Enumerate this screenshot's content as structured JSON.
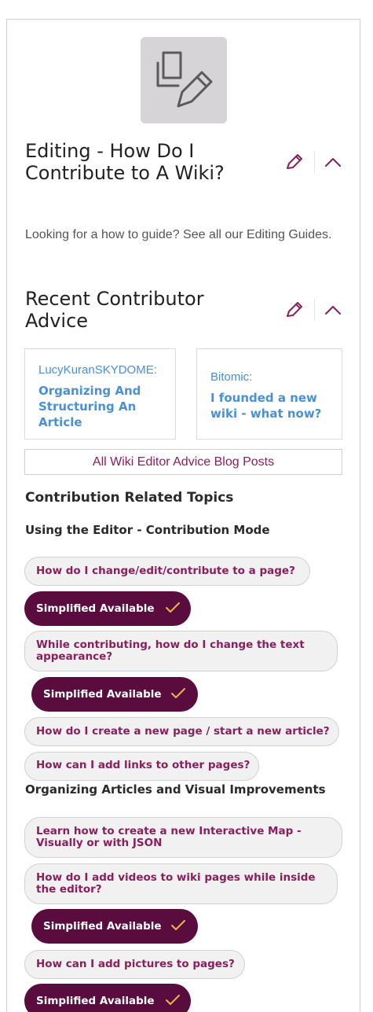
{
  "header": {
    "title": "Editing - How Do I Contribute to A Wiki?",
    "title_line1": "Editing - How Do I",
    "title_line2": "Contribute to A Wiki?"
  },
  "intro": {
    "text": "Looking for a how to guide? See all our Editing Guides."
  },
  "recent_advice": {
    "title_line1": "Recent Contributor",
    "title_line2": "Advice",
    "cards": [
      {
        "author": "LucyKuranSKYDOME:",
        "headline_lines": [
          "Organizing And",
          "Structuring An",
          "Article"
        ]
      },
      {
        "author": "Bitomic:",
        "headline_lines": [
          "I founded a new",
          "wiki - what now?"
        ]
      }
    ],
    "all_posts_label": "All Wiki Editor Advice Blog Posts"
  },
  "topics": {
    "heading": "Contribution Related Topics",
    "groups": [
      {
        "title": "Using the Editor - Contribution Mode",
        "items": [
          {
            "lines": [
              "How do I change/edit/contribute to a page?"
            ]
          },
          {
            "lines": [
              "While contributing, how do I change the text",
              "appearance?"
            ]
          },
          {
            "lines": [
              "How do I create a new page / start a new article?"
            ]
          },
          {
            "lines": [
              "How can I add links to other pages?"
            ]
          }
        ]
      },
      {
        "title": "Organizing Articles and Visual Improvements",
        "items": [
          {
            "lines": [
              "Learn how to create a new Interactive Map -",
              "Visually or with JSON"
            ]
          },
          {
            "lines": [
              "How do I add videos to wiki pages while inside",
              "the editor?"
            ]
          },
          {
            "lines": [
              "How can I add pictures to pages?"
            ]
          }
        ]
      }
    ],
    "simplified_label": "Simplified Available"
  },
  "icons": {
    "hero": "copy-edit-icon",
    "edit": "pencil-icon",
    "collapse": "chevron-up-icon",
    "badge": "checkmark-icon"
  },
  "colors": {
    "accent": "#8a1f5c",
    "badge_bg": "#5a0c3e",
    "badge_check": "#e8b74a",
    "link_blue": "#4a90d9",
    "pill_bg": "#f1f1f1"
  }
}
